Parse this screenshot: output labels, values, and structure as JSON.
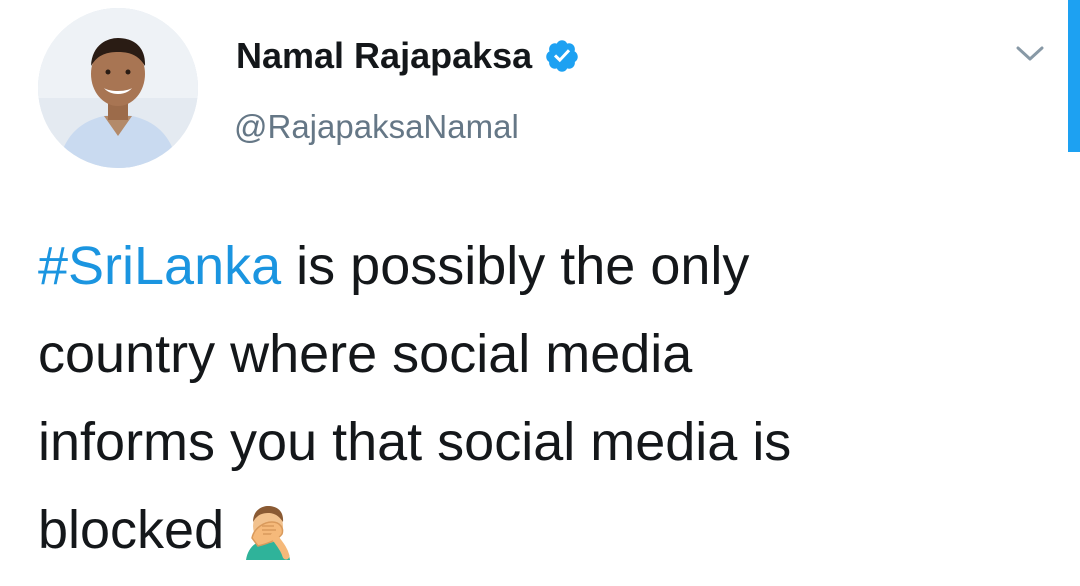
{
  "author": {
    "display_name": "Namal Rajapaksa",
    "handle": "@RajapaksaNamal",
    "verified_icon": "verified-badge-icon",
    "avatar_icon": "profile-avatar"
  },
  "tweet": {
    "hashtag": "#SriLanka",
    "text_line1_rest": " is possibly the only",
    "text_line2": "country where social media",
    "text_line3": "informs you that social media is",
    "text_line4": "blocked",
    "emoji_icon": "facepalm-emoji-icon"
  },
  "menu": {
    "icon": "chevron-down-icon"
  },
  "colors": {
    "text": "#14171a",
    "secondary": "#657786",
    "link": "#1b95e0",
    "verified": "#1da1f2"
  }
}
